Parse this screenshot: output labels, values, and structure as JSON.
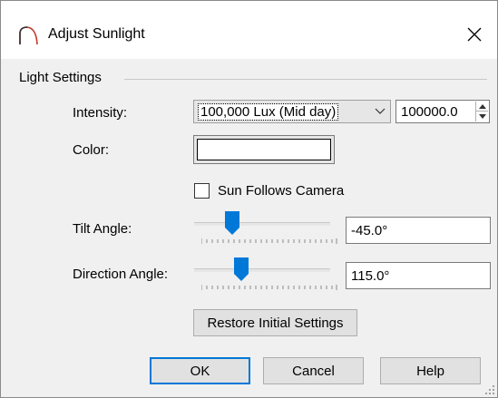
{
  "window": {
    "title": "Adjust Sunlight",
    "close_glyph": "✕",
    "icon": "sunlight-arc-icon"
  },
  "light_settings": {
    "group_label": "Light Settings",
    "intensity": {
      "label": "Intensity:",
      "preset_value": "100,000 Lux (Mid day)",
      "numeric_value": "100000.0"
    },
    "color": {
      "label": "Color:",
      "swatch_color": "#ffffff"
    },
    "sun_follows_camera": {
      "label": "Sun Follows Camera",
      "checked": false
    },
    "tilt_angle": {
      "label": "Tilt Angle:",
      "value": "-45.0°"
    },
    "direction_angle": {
      "label": "Direction Angle:",
      "value": "115.0°"
    },
    "restore_label": "Restore Initial Settings"
  },
  "buttons": {
    "ok": "OK",
    "cancel": "Cancel",
    "help": "Help"
  },
  "colors": {
    "slider_thumb": "#0078d7",
    "default_button_border": "#0078d7"
  }
}
